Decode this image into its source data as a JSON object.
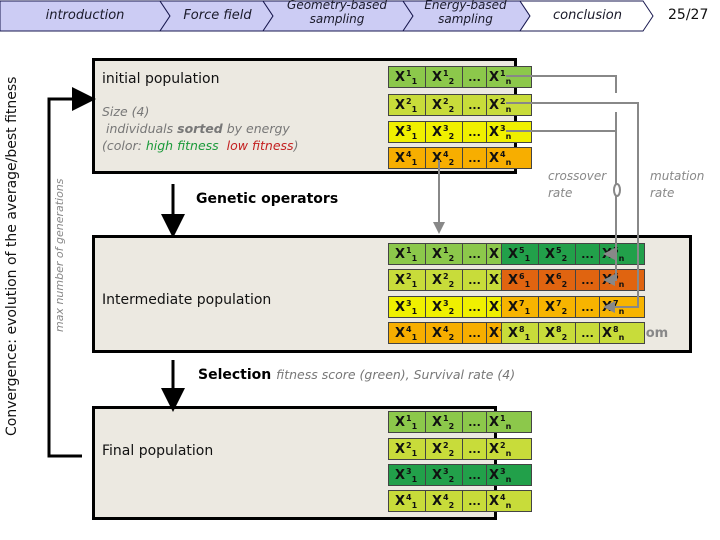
{
  "nav": {
    "items": [
      {
        "label": "introduction",
        "active": false
      },
      {
        "label": "Force field",
        "active": false
      },
      {
        "label": "Geometry-based sampling",
        "line1": "Geometry-based",
        "line2": "sampling",
        "active": false
      },
      {
        "label": "Energy-based sampling",
        "line1": "Energy-based",
        "line2": "sampling",
        "active": false
      },
      {
        "label": "conclusion",
        "active": true
      }
    ],
    "page": "25/27",
    "colors": {
      "inactive_fill": "#ccccf4",
      "active_fill": "#ffffff",
      "border": "#1a1a50"
    }
  },
  "side": {
    "convergence": "Convergence: evolution of the average/best fitness",
    "max_generations": "max number of generations"
  },
  "initial": {
    "title": "initial population",
    "size": "Size (4)",
    "sorted_pre": "individuals ",
    "sorted_bold": "sorted",
    "sorted_post": " by energy",
    "color_pre": "(color: ",
    "high": "high fitness",
    "low": "low fitness",
    "color_post": ")"
  },
  "operators": {
    "genetic": "Genetic operators",
    "selection": "Selection",
    "selection_note": "fitness score (green), Survival rate (4)",
    "crossover_l1": "crossover",
    "crossover_l2": "rate",
    "mutation_l1": "mutation",
    "mutation_l2": "rate",
    "random": "random"
  },
  "intermediate": {
    "title": "Intermediate population"
  },
  "final": {
    "title": "Final population"
  },
  "individuals": {
    "initial": [
      {
        "i": "1",
        "color": "#8cc84b"
      },
      {
        "i": "2",
        "color": "#c8dc3a"
      },
      {
        "i": "3",
        "color": "#f0f000"
      },
      {
        "i": "4",
        "color": "#f7ae00"
      }
    ],
    "intermediate_left": [
      {
        "i": "1",
        "color": "#8cc84b"
      },
      {
        "i": "2",
        "color": "#c8dc3a"
      },
      {
        "i": "3",
        "color": "#f0f000"
      },
      {
        "i": "4",
        "color": "#f7ae00"
      }
    ],
    "intermediate_right": [
      {
        "i": "5",
        "color": "#22a04a"
      },
      {
        "i": "6",
        "color": "#e06410"
      },
      {
        "i": "7",
        "color": "#f7b400"
      },
      {
        "i": "8",
        "color": "#c8dc3a"
      }
    ],
    "final": [
      {
        "i": "1",
        "color": "#8cc84b"
      },
      {
        "i": "2",
        "color": "#c8dc3a"
      },
      {
        "i": "3",
        "color": "#22a04a"
      },
      {
        "i": "4",
        "color": "#c8dc3a"
      }
    ],
    "ellipsis": "...",
    "var": "X",
    "sub1": "1",
    "sub2": "2",
    "subn": "n"
  }
}
